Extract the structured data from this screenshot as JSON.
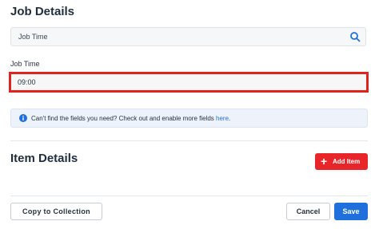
{
  "job_details": {
    "title": "Job Details",
    "search": {
      "value": "Job Time"
    },
    "field_label": "Job Time",
    "field_value": "09:00"
  },
  "info": {
    "message": "Can't find the fields you need? Check out and enable more fields",
    "link_text": "here",
    "suffix": "."
  },
  "item_details": {
    "title": "Item Details",
    "add_button": "Add Item"
  },
  "footer": {
    "copy_button": "Copy to Collection",
    "cancel_button": "Cancel",
    "save_button": "Save"
  },
  "colors": {
    "accent_blue": "#1f6fdc",
    "danger_red": "#e8262a",
    "highlight_border": "#e0231c"
  }
}
